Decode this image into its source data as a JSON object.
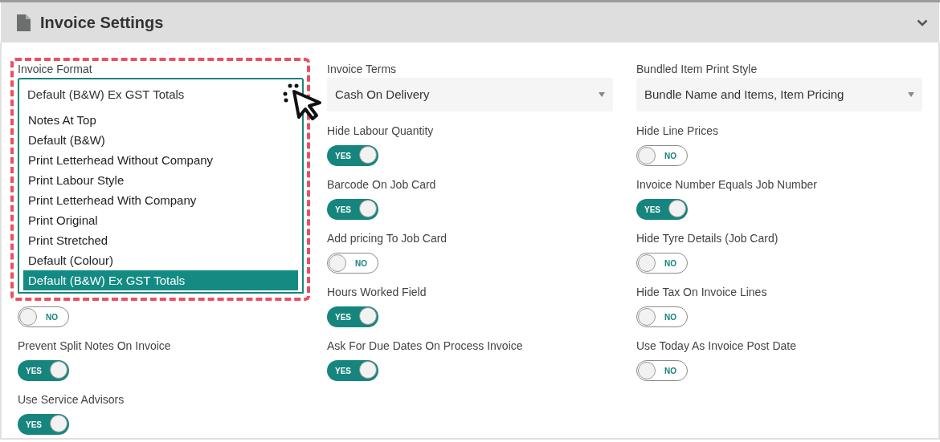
{
  "panel": {
    "title": "Invoice Settings"
  },
  "columns": [
    [
      {
        "kind": "select",
        "label": "Invoice Format",
        "value": "Default (B&W) Ex GST Totals",
        "expanded": true,
        "highlighted": true,
        "options": [
          {
            "label": "Notes At Top",
            "selected": false
          },
          {
            "label": "Default (B&W)",
            "selected": false
          },
          {
            "label": "Print Letterhead Without Company",
            "selected": false
          },
          {
            "label": "Print Labour Style",
            "selected": false
          },
          {
            "label": "Print Letterhead With Company",
            "selected": false
          },
          {
            "label": "Print Original",
            "selected": false
          },
          {
            "label": "Print Stretched",
            "selected": false
          },
          {
            "label": "Default (Colour)",
            "selected": false
          },
          {
            "label": "Default (B&W) Ex GST Totals",
            "selected": true
          }
        ]
      },
      {
        "kind": "toggle",
        "on": false,
        "text": "NO"
      },
      {
        "kind": "toggle",
        "label": "Prevent Split Notes On Invoice",
        "on": true,
        "text": "YES"
      },
      {
        "kind": "toggle",
        "label": "Use Service Advisors",
        "on": true,
        "text": "YES"
      }
    ],
    [
      {
        "kind": "select",
        "label": "Invoice Terms",
        "value": "Cash On Delivery",
        "expanded": false,
        "highlighted": false
      },
      {
        "kind": "toggle",
        "label": "Hide Labour Quantity",
        "on": true,
        "text": "YES"
      },
      {
        "kind": "toggle",
        "label": "Barcode On Job Card",
        "on": true,
        "text": "YES"
      },
      {
        "kind": "toggle",
        "label": "Add pricing To Job Card",
        "on": false,
        "text": "NO"
      },
      {
        "kind": "toggle",
        "label": "Hours Worked Field",
        "on": true,
        "text": "YES"
      },
      {
        "kind": "toggle",
        "label": "Ask For Due Dates On Process Invoice",
        "on": true,
        "text": "YES"
      }
    ],
    [
      {
        "kind": "select",
        "label": "Bundled Item Print Style",
        "value": "Bundle Name and Items, Item Pricing",
        "expanded": false,
        "highlighted": false
      },
      {
        "kind": "toggle",
        "label": "Hide Line Prices",
        "on": false,
        "text": "NO"
      },
      {
        "kind": "toggle",
        "label": "Invoice Number Equals Job Number",
        "on": true,
        "text": "YES"
      },
      {
        "kind": "toggle",
        "label": "Hide Tyre Details (Job Card)",
        "on": false,
        "text": "NO"
      },
      {
        "kind": "toggle",
        "label": "Hide Tax On Invoice Lines",
        "on": false,
        "text": "NO"
      },
      {
        "kind": "toggle",
        "label": "Use Today As Invoice Post Date",
        "on": false,
        "text": "NO"
      }
    ]
  ]
}
